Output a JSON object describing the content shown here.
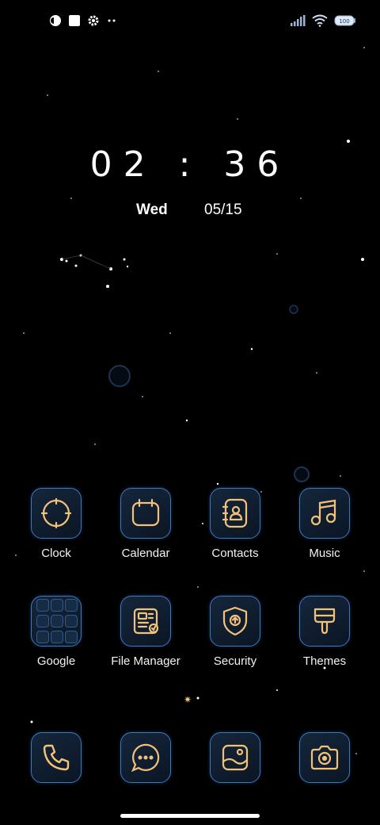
{
  "colors": {
    "accent": "#f2c27a",
    "tile_border": "#3d78c2",
    "background": "#000000"
  },
  "status_bar": {
    "left_icons": [
      "notification-app-icon",
      "square-notification-icon",
      "settings-gear-icon",
      "more-dots-icon"
    ],
    "right_icons": [
      "signal-bars-icon",
      "wifi-icon",
      "battery-icon"
    ],
    "battery_level": 100
  },
  "clock": {
    "time": "02 : 36",
    "day": "Wed",
    "date": "05/15"
  },
  "apps": {
    "row1": [
      {
        "label": "Clock",
        "icon": "clock-icon"
      },
      {
        "label": "Calendar",
        "icon": "calendar-icon"
      },
      {
        "label": "Contacts",
        "icon": "contacts-icon"
      },
      {
        "label": "Music",
        "icon": "music-note-icon"
      }
    ],
    "row2": [
      {
        "label": "Google",
        "icon": "google-folder-icon"
      },
      {
        "label": "File Manager",
        "icon": "file-manager-icon"
      },
      {
        "label": "Security",
        "icon": "security-shield-icon"
      },
      {
        "label": "Themes",
        "icon": "themes-brush-icon"
      }
    ]
  },
  "dock": [
    {
      "icon": "phone-icon"
    },
    {
      "icon": "messaging-icon"
    },
    {
      "icon": "gallery-icon"
    },
    {
      "icon": "camera-icon"
    }
  ]
}
